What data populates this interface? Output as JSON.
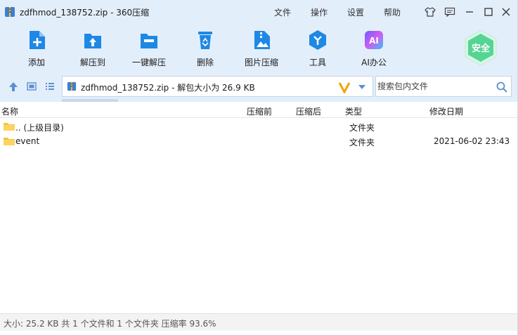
{
  "window": {
    "title": "zdfhmod_138752.zip - 360压缩"
  },
  "menu": {
    "file": "文件",
    "operate": "操作",
    "settings": "设置",
    "help": "帮助"
  },
  "toolbar": {
    "add": "添加",
    "extract_to": "解压到",
    "one_click_extract": "一键解压",
    "delete": "删除",
    "image_compress": "图片压缩",
    "tools": "工具",
    "ai_office": "AI办公",
    "ai_badge": "AI"
  },
  "safe_badge": "安全",
  "address": {
    "path": "zdfhmod_138752.zip - 解包大小为 26.9 KB"
  },
  "search": {
    "placeholder": "搜索包内文件"
  },
  "columns": {
    "name": "名称",
    "before": "压缩前",
    "after": "压缩后",
    "type": "类型",
    "modified": "修改日期"
  },
  "rows": [
    {
      "name": ".. (上级目录)",
      "type": "文件夹",
      "modified": ""
    },
    {
      "name": "event",
      "type": "文件夹",
      "modified": "2021-06-02 23:43"
    }
  ],
  "status": "大小: 25.2 KB 共 1 个文件和 1 个文件夹 压缩率 93.6%",
  "colors": {
    "chrome_bg": "#e3eefb",
    "icon_blue": "#1e88e5",
    "safe_green": "#4cd08a",
    "folder_yellow": "#f5c242"
  }
}
